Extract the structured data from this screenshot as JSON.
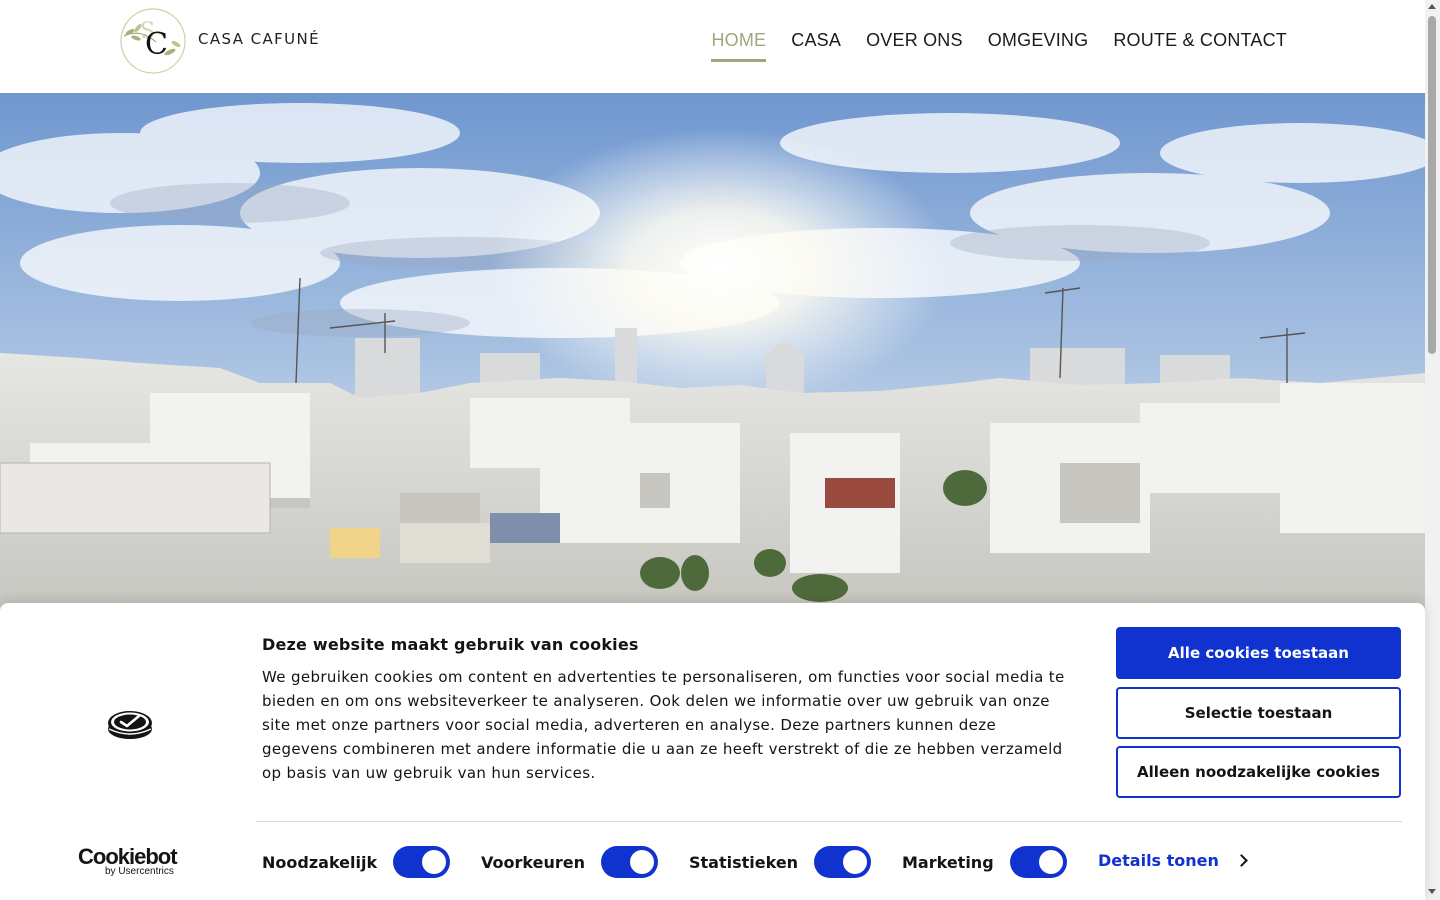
{
  "header": {
    "logo_text": "CASA CAFUNÉ",
    "nav": [
      {
        "label": "HOME",
        "active": true
      },
      {
        "label": "CASA",
        "active": false
      },
      {
        "label": "OVER ONS",
        "active": false
      },
      {
        "label": "OMGEVING",
        "active": false
      },
      {
        "label": "ROUTE & CONTACT",
        "active": false
      }
    ],
    "accent_color": "#a3a57a"
  },
  "hero": {
    "image_icon": "rooftop-panorama-photo"
  },
  "cookie_banner": {
    "title": "Deze website maakt gebruik van cookies",
    "body": "We gebruiken cookies om content en advertenties te personaliseren, om functies voor social media te bieden en om ons websiteverkeer te analyseren. Ook delen we informatie over uw gebruik van onze site met onze partners voor social media, adverteren en analyse. Deze partners kunnen deze gegevens combineren met andere informatie die u aan ze heeft verstrekt of die ze hebben verzameld op basis van uw gebruik van hun services.",
    "buttons": {
      "allow_all": "Alle cookies toestaan",
      "allow_selection": "Selectie toestaan",
      "necessary_only": "Alleen noodzakelijke cookies"
    },
    "toggles": [
      {
        "label": "Noodzakelijk",
        "checked": true
      },
      {
        "label": "Voorkeuren",
        "checked": true
      },
      {
        "label": "Statistieken",
        "checked": true
      },
      {
        "label": "Marketing",
        "checked": true
      }
    ],
    "details_link": "Details tonen",
    "brand": {
      "name": "Cookiebot",
      "byline": "by Usercentrics"
    },
    "accent_color": "#1032cf"
  }
}
